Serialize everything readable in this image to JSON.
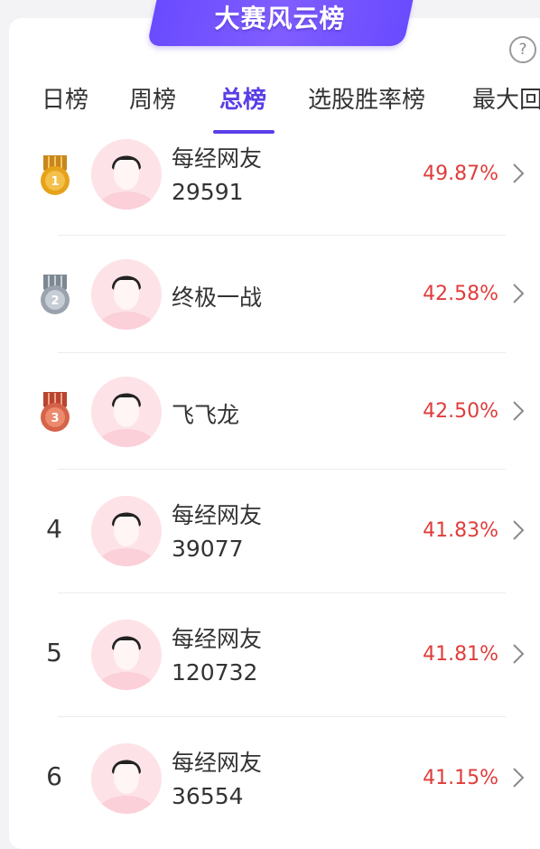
{
  "header": {
    "title": "大赛风云榜",
    "help_icon": "?"
  },
  "tabs": [
    {
      "label": "日榜",
      "active": false
    },
    {
      "label": "周榜",
      "active": false
    },
    {
      "label": "总榜",
      "active": true
    },
    {
      "label": "选股胜率榜",
      "active": false
    },
    {
      "label": "最大回",
      "active": false
    }
  ],
  "colors": {
    "accent": "#5a3ee6",
    "rate": "#e03c3c",
    "gold": "#e6a21a",
    "silver": "#9aa3ad",
    "bronze": "#d5634a"
  },
  "rankings": [
    {
      "rank": "1",
      "medal": "gold",
      "name": "每经网友",
      "uid": "29591",
      "rate": "49.87%"
    },
    {
      "rank": "2",
      "medal": "silver",
      "name": "终极一战",
      "uid": "",
      "rate": "42.58%"
    },
    {
      "rank": "3",
      "medal": "bronze",
      "name": "飞飞龙",
      "uid": "",
      "rate": "42.50%"
    },
    {
      "rank": "4",
      "medal": "",
      "name": "每经网友",
      "uid": "39077",
      "rate": "41.83%"
    },
    {
      "rank": "5",
      "medal": "",
      "name": "每经网友",
      "uid": "120732",
      "rate": "41.81%"
    },
    {
      "rank": "6",
      "medal": "",
      "name": "每经网友",
      "uid": "36554",
      "rate": "41.15%"
    }
  ]
}
